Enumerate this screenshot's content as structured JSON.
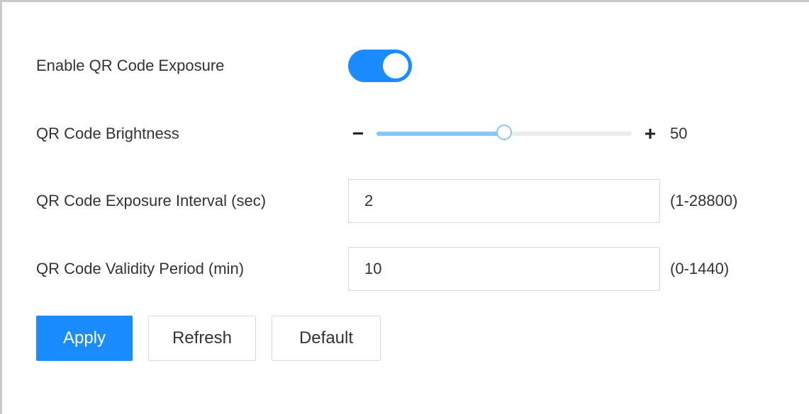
{
  "settings": {
    "enable_exposure": {
      "label": "Enable QR Code Exposure",
      "enabled": true
    },
    "brightness": {
      "label": "QR Code Brightness",
      "minus_symbol": "−",
      "plus_symbol": "+",
      "value": "50",
      "min": 0,
      "max": 100
    },
    "exposure_interval": {
      "label": "QR Code Exposure Interval (sec)",
      "value": "2",
      "range": "(1-28800)"
    },
    "validity_period": {
      "label": "QR Code Validity Period (min)",
      "value": "10",
      "range": "(0-1440)"
    }
  },
  "actions": {
    "apply_label": "Apply",
    "refresh_label": "Refresh",
    "default_label": "Default"
  },
  "colors": {
    "primary": "#1a8cff",
    "slider_fill": "#8ac6f5",
    "border": "#d9d9d9"
  }
}
